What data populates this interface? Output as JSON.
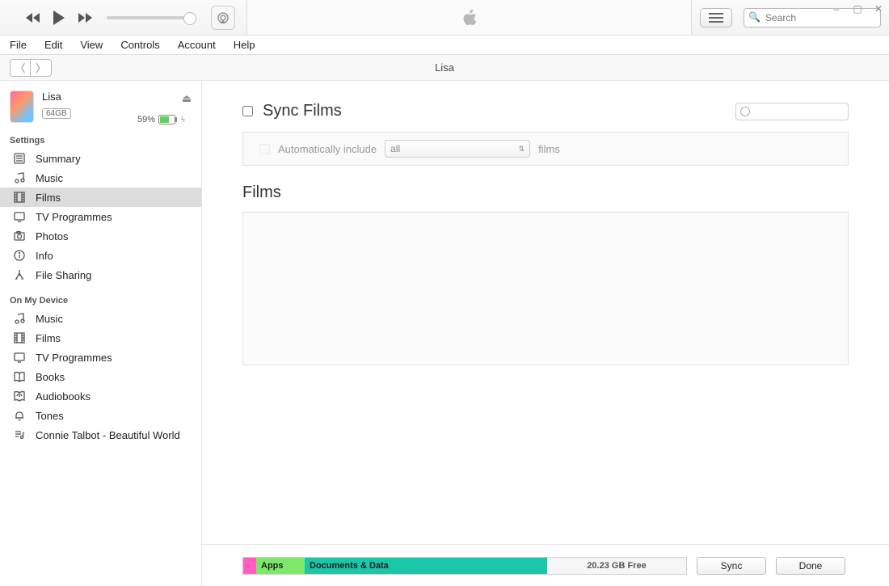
{
  "window": {
    "minimize": "–",
    "maximize": "▢",
    "close": "✕"
  },
  "search": {
    "placeholder": "Search"
  },
  "menu": {
    "file": "File",
    "edit": "Edit",
    "view": "View",
    "controls": "Controls",
    "account": "Account",
    "help": "Help"
  },
  "nav": {
    "title": "Lisa"
  },
  "device": {
    "name": "Lisa",
    "capacity": "64GB",
    "battery_text": "59%"
  },
  "sidebar": {
    "settings_header": "Settings",
    "settings": [
      {
        "label": "Summary",
        "icon": "summary-icon"
      },
      {
        "label": "Music",
        "icon": "music-icon"
      },
      {
        "label": "Films",
        "icon": "films-icon",
        "selected": true
      },
      {
        "label": "TV Programmes",
        "icon": "tv-icon"
      },
      {
        "label": "Photos",
        "icon": "camera-icon"
      },
      {
        "label": "Info",
        "icon": "info-icon"
      },
      {
        "label": "File Sharing",
        "icon": "appstore-icon"
      }
    ],
    "device_header": "On My Device",
    "device_items": [
      {
        "label": "Music",
        "icon": "music-icon"
      },
      {
        "label": "Films",
        "icon": "films-icon"
      },
      {
        "label": "TV Programmes",
        "icon": "tv-icon"
      },
      {
        "label": "Books",
        "icon": "book-icon"
      },
      {
        "label": "Audiobooks",
        "icon": "audiobook-icon"
      },
      {
        "label": "Tones",
        "icon": "bell-icon"
      },
      {
        "label": "Connie Talbot - Beautiful World",
        "icon": "playlist-icon"
      }
    ]
  },
  "content": {
    "sync_title": "Sync Films",
    "auto_pre": "Automatically include",
    "auto_select": "all",
    "auto_post": "films",
    "films_title": "Films"
  },
  "storage": {
    "apps": "Apps",
    "docs": "Documents & Data",
    "free": "20.23 GB Free"
  },
  "buttons": {
    "sync": "Sync",
    "done": "Done"
  }
}
